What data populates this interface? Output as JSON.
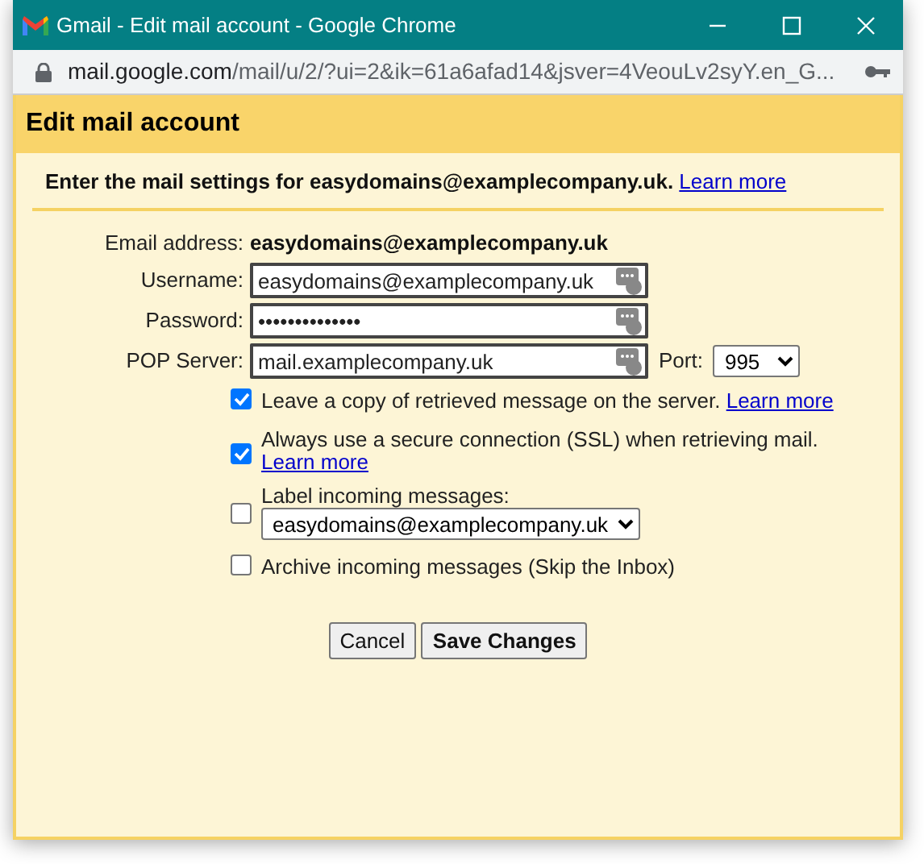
{
  "window": {
    "title": "Gmail - Edit mail account - Google Chrome"
  },
  "address_bar": {
    "host": "mail.google.com",
    "path": "/mail/u/2/?ui=2&ik=61a6afad14&jsver=4VeouLv2syY.en_G..."
  },
  "dialog": {
    "title": "Edit mail account",
    "intro": "Enter the mail settings for easydomains@examplecompany.uk.",
    "intro_link": "Learn more",
    "email_label": "Email address:",
    "email_value": "easydomains@examplecompany.uk",
    "fields": [
      {
        "label": "Username:",
        "value": "easydomains@examplecompany.uk"
      },
      {
        "label": "Password:",
        "value": "••••••••••••••"
      },
      {
        "label": "POP Server:",
        "value": "mail.examplecompany.uk"
      }
    ],
    "port": {
      "label": "Port:",
      "value": "995"
    },
    "options": [
      {
        "kind": "plain",
        "label": "Leave a copy of retrieved message on the server.",
        "link": "Learn more",
        "checked": true
      },
      {
        "kind": "wrap",
        "label": "Always use a secure connection (SSL) when retrieving mail.",
        "link": "Learn more",
        "checked": true
      },
      {
        "kind": "select",
        "label": "Label incoming messages:",
        "select_value": "easydomains@examplecompany.uk",
        "checked": false
      },
      {
        "kind": "plain",
        "label": "Archive incoming messages (Skip the Inbox)",
        "checked": false
      }
    ],
    "buttons": [
      {
        "label": "Cancel",
        "primary": false
      },
      {
        "label": "Save Changes",
        "primary": true
      }
    ]
  }
}
